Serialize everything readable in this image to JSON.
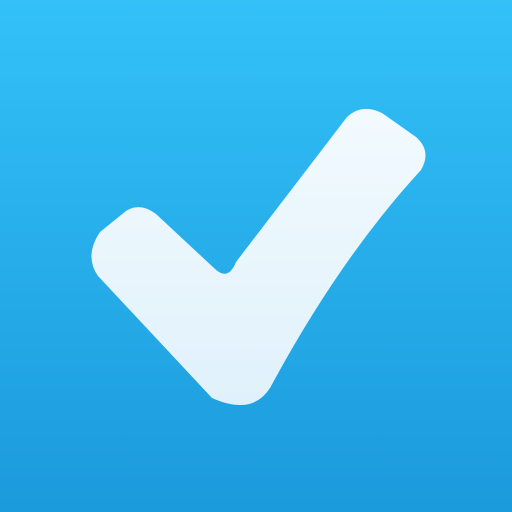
{
  "icon": {
    "name": "checkmark-icon",
    "background_gradient": {
      "top": "#33C1F8",
      "bottom": "#1B9ADC"
    },
    "check_gradient": {
      "top": "#F2FAFE",
      "bottom": "#E0F1FB"
    }
  }
}
